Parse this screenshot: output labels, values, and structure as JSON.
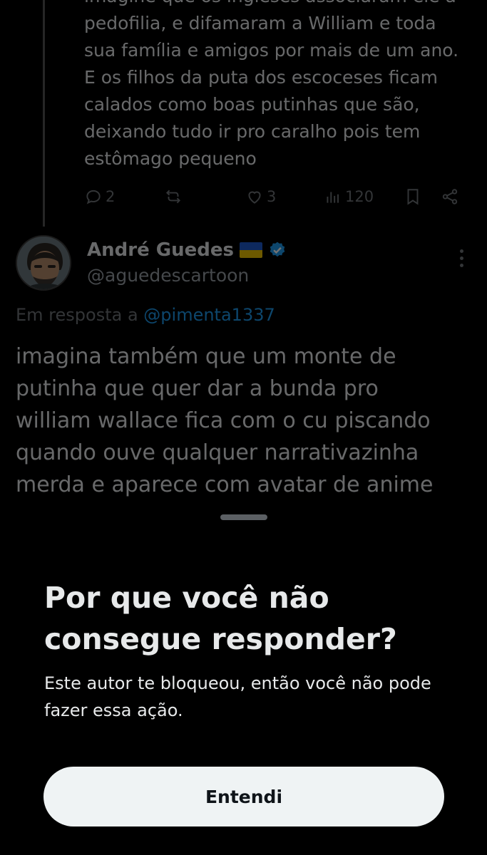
{
  "previous_tweet": {
    "lines": [
      "imagine que os ingleses associaram ele a",
      "pedofilia, e difamaram a William e toda",
      "sua família e amigos  por mais de um ano.",
      "E os filhos da puta dos escoceses ficam",
      "calados como boas putinhas que são,",
      "deixando tudo ir pro caralho pois tem",
      "estômago pequeno"
    ],
    "actions": {
      "replies": "2",
      "reposts": "",
      "likes": "3",
      "views": "120"
    }
  },
  "reply_tweet": {
    "display_name": "André Guedes",
    "handle": "@aguedescartoon",
    "replying_prefix": "Em resposta a",
    "replying_to": "@pimenta1337",
    "lines": [
      "imagina também que um monte de",
      "putinha que quer dar a bunda pro",
      "william wallace fica com o cu piscando",
      "quando ouve qualquer narrativazinha",
      "merda e aparece com avatar de anime"
    ]
  },
  "sheet": {
    "title": "Por que você não consegue responder?",
    "description": "Este autor te bloqueou, então você não pode fazer essa ação.",
    "button_label": "Entendi"
  },
  "colors": {
    "background": "#000000",
    "text": "#e7e9ea",
    "muted": "#71767b",
    "link": "#1d9bf0",
    "verified": "#1d9bf0",
    "button_bg": "#eff3f4"
  },
  "icons": [
    "reply-icon",
    "repost-icon",
    "like-icon",
    "views-icon",
    "bookmark-icon",
    "share-icon",
    "verified-icon",
    "ukraine-flag-icon",
    "more-icon"
  ]
}
